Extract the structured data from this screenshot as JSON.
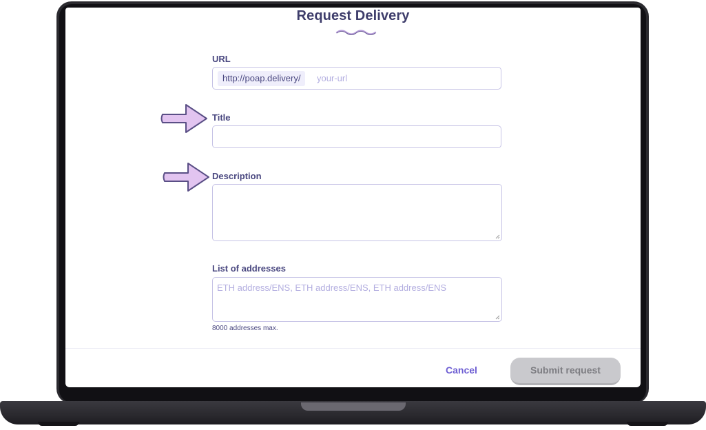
{
  "form": {
    "title": "Request Delivery",
    "url": {
      "label": "URL",
      "prefix": "http://poap.delivery/",
      "placeholder": "your-url"
    },
    "title_field": {
      "label": "Title",
      "value": ""
    },
    "description_field": {
      "label": "Description",
      "value": ""
    },
    "addresses": {
      "label": "List of addresses",
      "placeholder": "ETH address/ENS, ETH address/ENS, ETH address/ENS",
      "hint": "8000 addresses max."
    },
    "actions": {
      "cancel": "Cancel",
      "submit": "Submit request"
    }
  },
  "colors": {
    "accent": "#6e5fd3",
    "label": "#4a4880",
    "arrow_fill": "#e2c4f0",
    "arrow_stroke": "#5a4f86"
  },
  "icons": {
    "pointer": "arrow-right-icon",
    "wave": "wave-divider-icon"
  }
}
